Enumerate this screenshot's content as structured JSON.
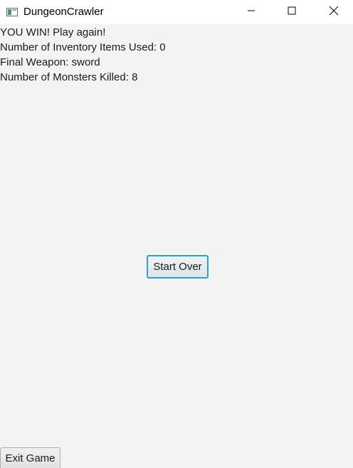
{
  "window": {
    "title": "DungeonCrawler",
    "app_icon": "window-app-icon",
    "controls": {
      "minimize_icon": "minimize-icon",
      "maximize_icon": "maximize-icon",
      "close_icon": "close-icon"
    }
  },
  "results": {
    "win_message": "YOU WIN! Play again!",
    "inventory_used": "Number of Inventory Items Used: 0",
    "final_weapon": "Final Weapon: sword",
    "monsters_killed": "Number of Monsters Killed: 8"
  },
  "buttons": {
    "start_over": "Start Over",
    "exit_game": "Exit Game"
  },
  "colors": {
    "background": "#f3f3f3",
    "titlebar": "#ffffff",
    "focus_accent": "#2ba0d6"
  }
}
